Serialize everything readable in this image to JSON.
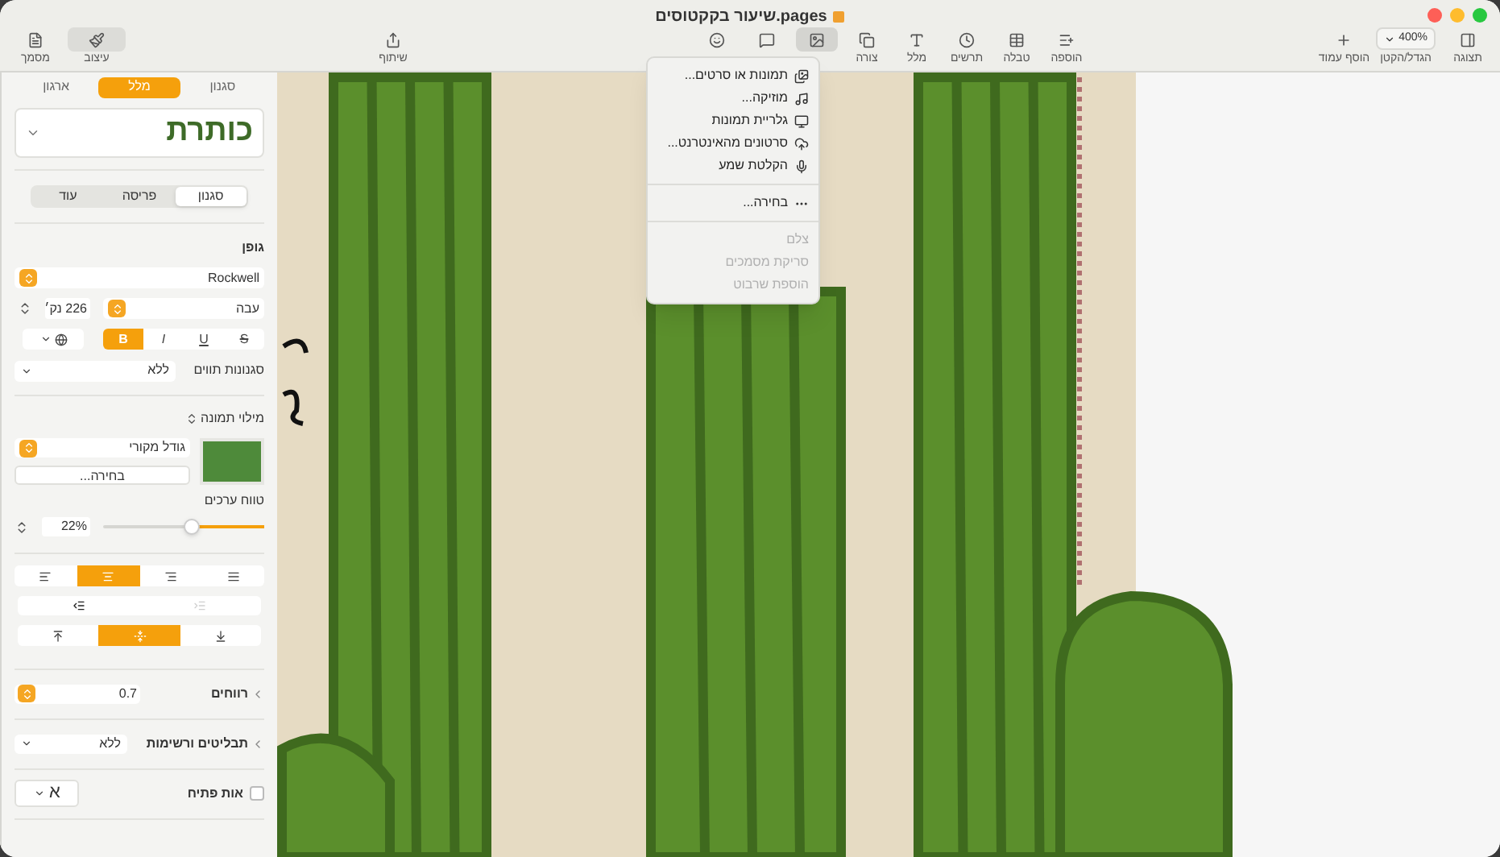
{
  "window": {
    "title": "שיעור בקקטוסים.pages"
  },
  "toolbar": {
    "left": [
      {
        "label": "עיצוב",
        "selected": true
      },
      {
        "label": "מסמך",
        "selected": false
      }
    ],
    "share": {
      "label": "שיתוף"
    },
    "insert": [
      {
        "label": "הוספה",
        "selected": false
      },
      {
        "label": "טבלה",
        "selected": false
      },
      {
        "label": "תרשים",
        "selected": false
      },
      {
        "label": "מלל",
        "selected": false
      },
      {
        "label": "צורה",
        "selected": false
      },
      {
        "selected": true
      },
      {
        "selected": false
      },
      {
        "selected": false
      }
    ],
    "add_page": {
      "label": "הוסף עמוד"
    },
    "zoom": {
      "value": "400%",
      "label": "הגדל/הקטן"
    },
    "view": {
      "label": "תצוגה"
    }
  },
  "insert_menu": {
    "groups": [
      [
        {
          "label": "תמונות או סרטים...",
          "disabled": false
        },
        {
          "label": "מוזיקה...",
          "disabled": false
        },
        {
          "label": "גלריית תמונות",
          "disabled": false
        },
        {
          "label": "סרטונים מהאינטרנט...",
          "disabled": false
        },
        {
          "label": "הקלטת שמע",
          "disabled": false
        }
      ],
      [
        {
          "label": "בחירה...",
          "disabled": false
        }
      ],
      [
        {
          "label": "צלם",
          "disabled": true
        },
        {
          "label": "סריקת מסמכים",
          "disabled": true
        },
        {
          "label": "הוספת שרבוט",
          "disabled": true
        }
      ]
    ]
  },
  "inspector": {
    "tabs": [
      {
        "label": "סגנון",
        "selected": false
      },
      {
        "label": "מלל",
        "selected": true
      },
      {
        "label": "ארגון",
        "selected": false
      }
    ],
    "paragraph_style": "כותרת",
    "subtabs": [
      {
        "label": "סגנון",
        "selected": true
      },
      {
        "label": "פריסה",
        "selected": false
      },
      {
        "label": "עוד",
        "selected": false
      }
    ],
    "font": {
      "heading": "גופן",
      "family": "Rockwell",
      "typeface": "עבה",
      "size": "226 נק׳",
      "styles": [
        {
          "label": "S",
          "selected": false
        },
        {
          "label": "U",
          "selected": false
        },
        {
          "label": "I",
          "selected": false
        },
        {
          "label": "B",
          "selected": true
        }
      ]
    },
    "character_styles": {
      "label": "סגנונות תווים",
      "value": "ללא"
    },
    "image_fill": {
      "label": "מילוי תמונה",
      "scale": "גודל מקורי",
      "choose": "בחירה..."
    },
    "value_range": {
      "label": "טווח ערכים",
      "value": "22%",
      "level": 0.45
    },
    "alignment": [
      {
        "selected": false
      },
      {
        "selected": false
      },
      {
        "selected": true
      },
      {
        "selected": false
      }
    ],
    "indent": [
      {
        "disabled": true
      },
      {
        "disabled": false
      }
    ],
    "vertical": [
      {
        "selected": false
      },
      {
        "selected": true
      },
      {
        "selected": false
      }
    ],
    "spacing": {
      "label": "רווחים",
      "value": "0.7"
    },
    "bullets": {
      "label": "תבליטים ורשימות",
      "value": "ללא"
    },
    "drop_cap": {
      "label": "אות פתיח",
      "checked": false,
      "sample": "א"
    }
  }
}
